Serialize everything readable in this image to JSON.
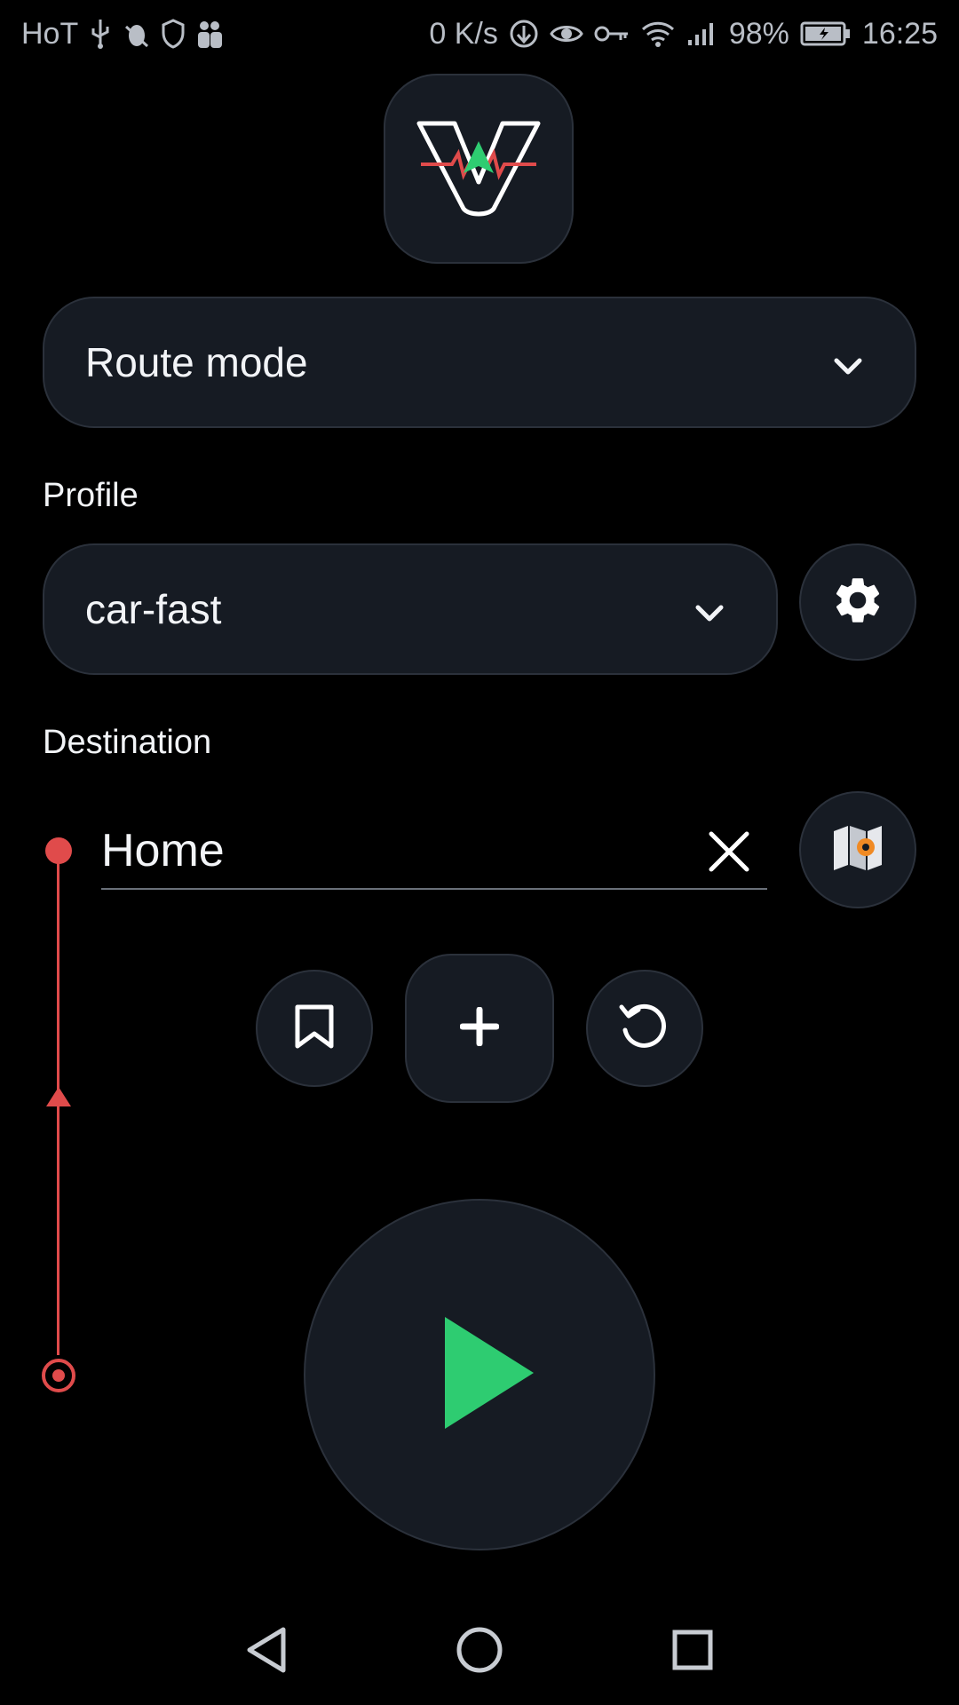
{
  "status_bar": {
    "carrier": "HoT",
    "net_speed": "0 K/s",
    "battery_percent": "98%",
    "time": "16:25",
    "left_icons": [
      "usb-icon",
      "bug-icon",
      "shield-icon",
      "users-icon"
    ],
    "right_icons": [
      "data-saver-icon",
      "eye-icon",
      "key-icon",
      "wifi-icon",
      "signal-icon",
      "battery-charging-icon"
    ]
  },
  "mode_selector": {
    "selected": "Route mode"
  },
  "profile": {
    "label": "Profile",
    "selected": "car-fast"
  },
  "destination": {
    "label": "Destination",
    "value": "Home"
  },
  "colors": {
    "background": "#000000",
    "surface": "#161b23",
    "border": "#2b313b",
    "accent_green": "#2ecc71",
    "route_red": "#e04b4b",
    "map_pin_orange": "#f08a24"
  }
}
